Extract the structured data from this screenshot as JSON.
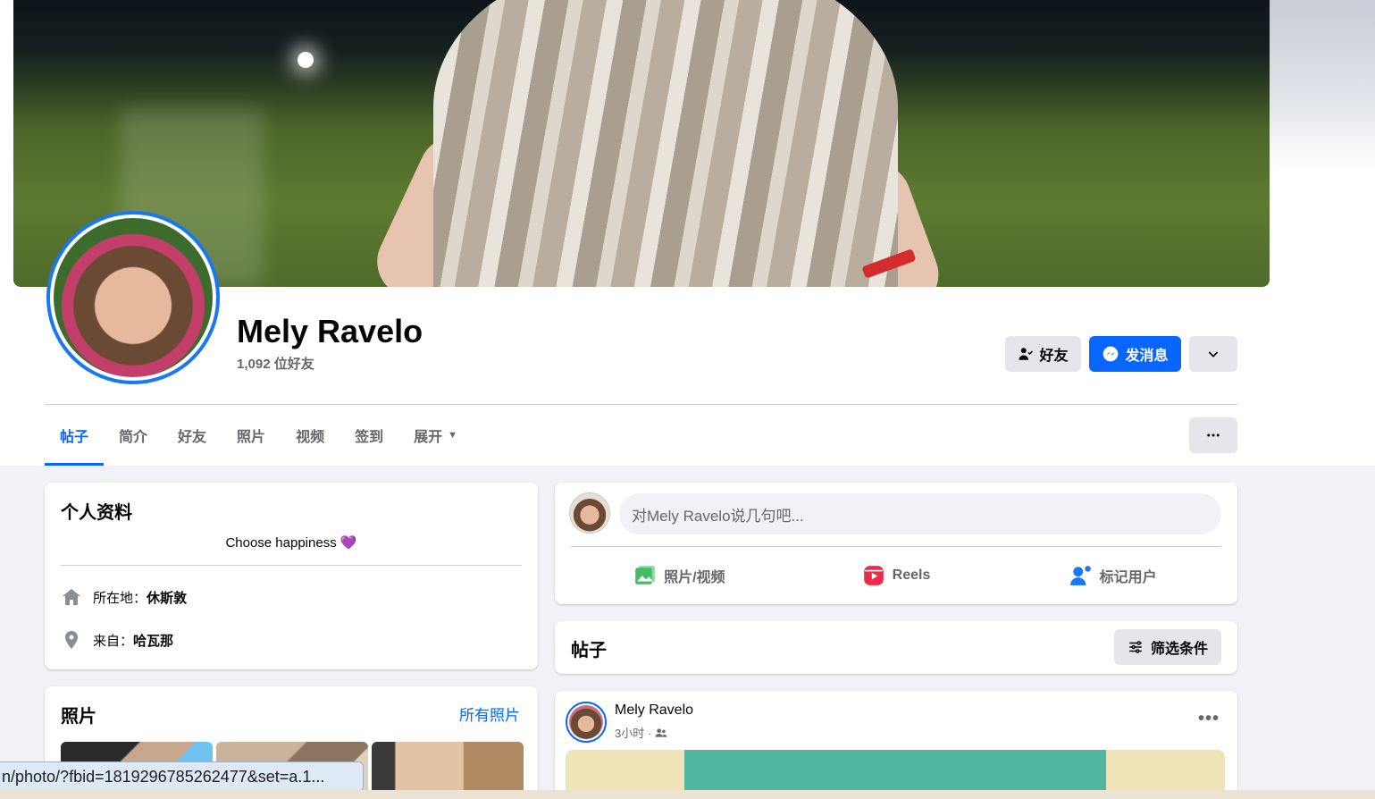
{
  "profile": {
    "name": "Mely Ravelo",
    "friends_count": "1,092 位好友"
  },
  "actions": {
    "friends_label": "好友",
    "message_label": "发消息",
    "dropdown_icon": "chevron-down-icon",
    "more_icon": "ellipsis-icon"
  },
  "tabs": [
    {
      "label": "帖子",
      "active": true
    },
    {
      "label": "简介"
    },
    {
      "label": "好友"
    },
    {
      "label": "照片"
    },
    {
      "label": "视频"
    },
    {
      "label": "签到"
    },
    {
      "label": "展开"
    }
  ],
  "intro": {
    "title": "个人资料",
    "bio": "Choose happiness 💜",
    "lives_prefix": "所在地：",
    "lives_value": "休斯敦",
    "from_prefix": "来自：",
    "from_value": "哈瓦那"
  },
  "photos": {
    "title": "照片",
    "all_link": "所有照片"
  },
  "composer": {
    "placeholder": "对Mely Ravelo说几句吧...",
    "photo_video": "照片/视频",
    "reels": "Reels",
    "tag_people": "标记用户"
  },
  "posts_header": {
    "title": "帖子",
    "filter_label": "筛选条件"
  },
  "post": {
    "author": "Mely Ravelo",
    "time": "3小时 ·"
  },
  "status_bar": {
    "url": "n/photo/?fbid=1819296785262477&set=a.1..."
  },
  "colors": {
    "accent": "#0866ff",
    "page_bg": "#f0f2f5",
    "button_grey": "#e4e6eb"
  }
}
